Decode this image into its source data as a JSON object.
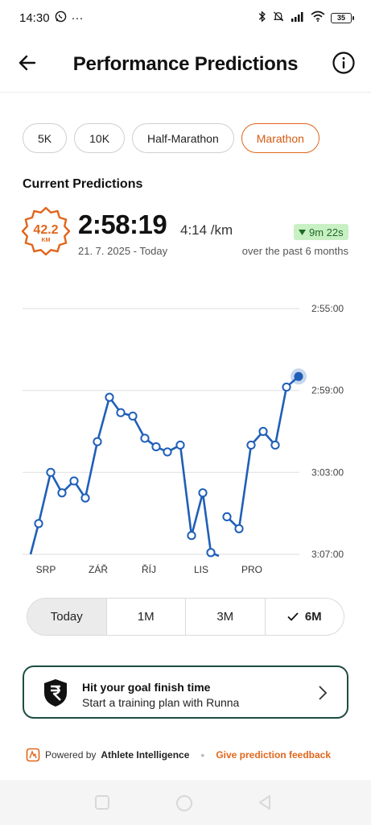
{
  "status": {
    "time": "14:30",
    "more": "···",
    "battery": "35"
  },
  "header": {
    "title": "Performance Predictions"
  },
  "distance_tabs": [
    "5K",
    "10K",
    "Half-Marathon",
    "Marathon"
  ],
  "selected_distance": "Marathon",
  "current": {
    "section_title": "Current Predictions",
    "badge_value": "42.2",
    "badge_unit": "KM",
    "time": "2:58:19",
    "pace": "4:14 /km",
    "date_range": "21. 7. 2025 - Today",
    "delta": "9m 22s",
    "delta_caption": "over the past 6 months"
  },
  "chart_data": {
    "type": "line",
    "y_axis_labels": [
      "2:55:00",
      "2:59:00",
      "3:03:00",
      "3:07:00"
    ],
    "y_axis_seconds": [
      10500,
      10740,
      10980,
      11220
    ],
    "y_reversed": true,
    "x_labels": [
      "SRP",
      "ZÁŘ",
      "ŘÍJ",
      "LIS",
      "PRO"
    ],
    "series": [
      {
        "values": [
          11220,
          11130,
          10980,
          11040,
          11005,
          11055,
          10890,
          10760,
          10805,
          10815,
          10880,
          10905,
          10920,
          10900,
          11165,
          11040,
          11215,
          11225,
          11110,
          11145,
          10900,
          10860,
          10900,
          10730,
          10699
        ]
      }
    ],
    "grid": true,
    "line_color": "#1f5fb8"
  },
  "range_tabs": [
    "Today",
    "1M",
    "3M",
    "6M"
  ],
  "selected_range": "6M",
  "cta": {
    "title": "Hit your goal finish time",
    "subtitle": "Start a training plan with Runna"
  },
  "footer": {
    "powered_prefix": "Powered by",
    "brand": "Athlete Intelligence",
    "feedback": "Give prediction feedback"
  },
  "colors": {
    "accent": "#e0661c",
    "cta_border": "#1c4d43",
    "line": "#1f5fb8",
    "delta_bg": "#c9f0c4"
  }
}
